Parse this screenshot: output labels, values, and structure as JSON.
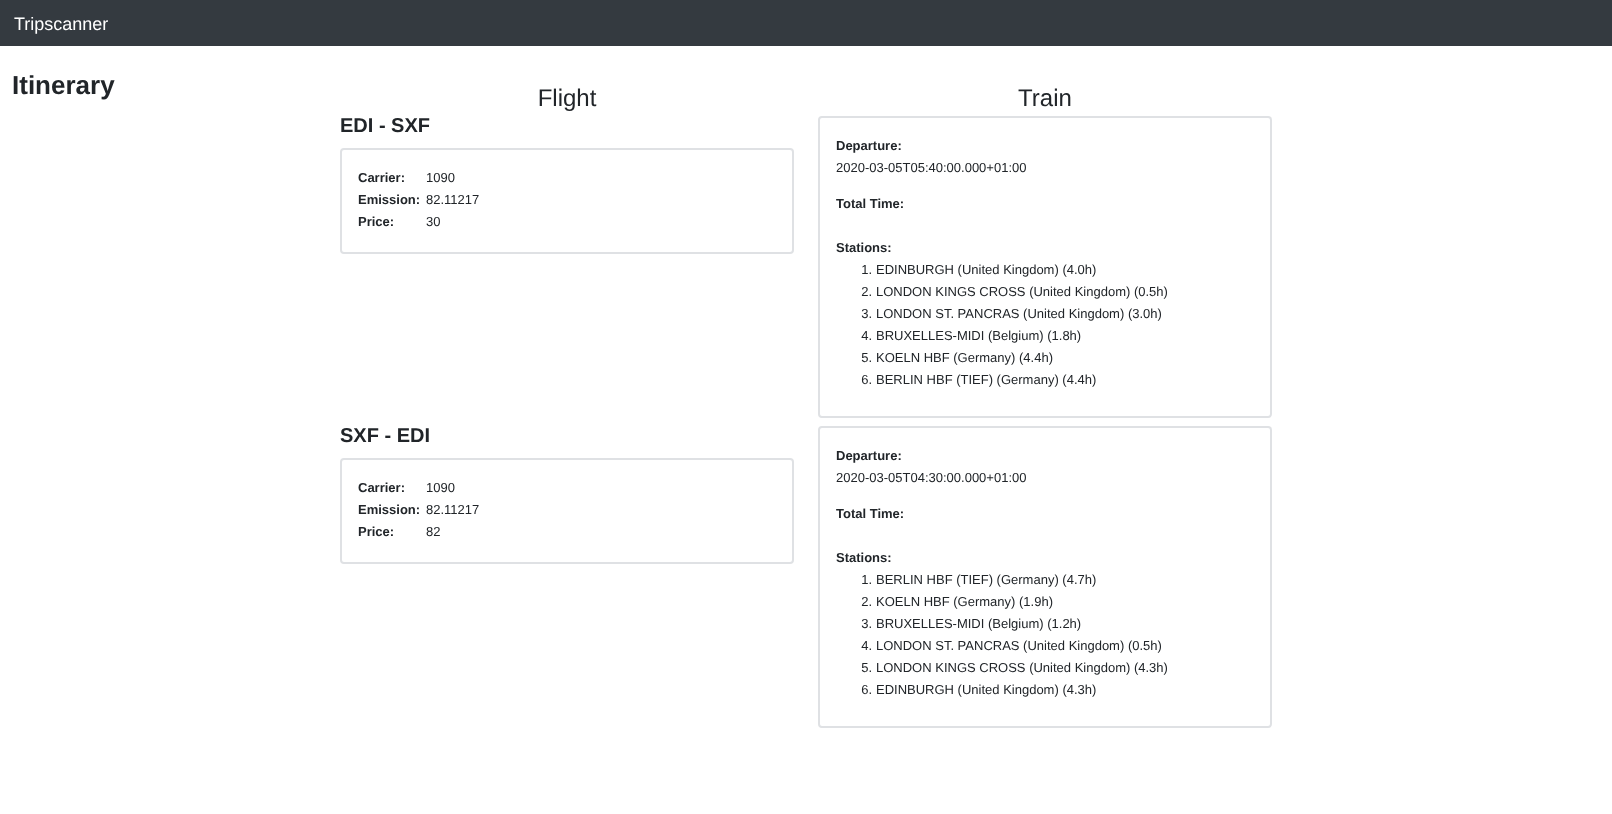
{
  "navbar": {
    "brand": "Tripscanner"
  },
  "page_title": "Itinerary",
  "columns": [
    "Flight",
    "Train"
  ],
  "trips": [
    {
      "flight": {
        "route": "EDI - SXF",
        "fields": [
          {
            "label": "Carrier:",
            "value": "1090"
          },
          {
            "label": "Emission:",
            "value": "82.11217"
          },
          {
            "label": "Price:",
            "value": "30"
          }
        ]
      },
      "train": {
        "departure_label": "Departure:",
        "departure": "2020-03-05T05:40:00.000+01:00",
        "total_time_label": "Total Time:",
        "stations_label": "Stations:",
        "stations": [
          {
            "number": "1.",
            "name": "EDINBURGH (United Kingdom) (4.0h)"
          },
          {
            "number": "2.",
            "name": "LONDON KINGS CROSS (United Kingdom) (0.5h)"
          },
          {
            "number": "3.",
            "name": "LONDON ST. PANCRAS (United Kingdom) (3.0h)"
          },
          {
            "number": "4.",
            "name": "BRUXELLES-MIDI (Belgium) (1.8h)"
          },
          {
            "number": "5.",
            "name": "KOELN HBF (Germany) (4.4h)"
          },
          {
            "number": "6.",
            "name": "BERLIN HBF (TIEF) (Germany) (4.4h)"
          }
        ]
      }
    },
    {
      "flight": {
        "route": "SXF - EDI",
        "fields": [
          {
            "label": "Carrier:",
            "value": "1090"
          },
          {
            "label": "Emission:",
            "value": "82.11217"
          },
          {
            "label": "Price:",
            "value": "82"
          }
        ]
      },
      "train": {
        "departure_label": "Departure:",
        "departure": "2020-03-05T04:30:00.000+01:00",
        "total_time_label": "Total Time:",
        "stations_label": "Stations:",
        "stations": [
          {
            "number": "1.",
            "name": "BERLIN HBF (TIEF) (Germany) (4.7h)"
          },
          {
            "number": "2.",
            "name": "KOELN HBF (Germany) (1.9h)"
          },
          {
            "number": "3.",
            "name": "BRUXELLES-MIDI (Belgium) (1.2h)"
          },
          {
            "number": "4.",
            "name": "LONDON ST. PANCRAS (United Kingdom) (0.5h)"
          },
          {
            "number": "5.",
            "name": "LONDON KINGS CROSS (United Kingdom) (4.3h)"
          },
          {
            "number": "6.",
            "name": "EDINBURGH (United Kingdom) (4.3h)"
          }
        ]
      }
    }
  ]
}
